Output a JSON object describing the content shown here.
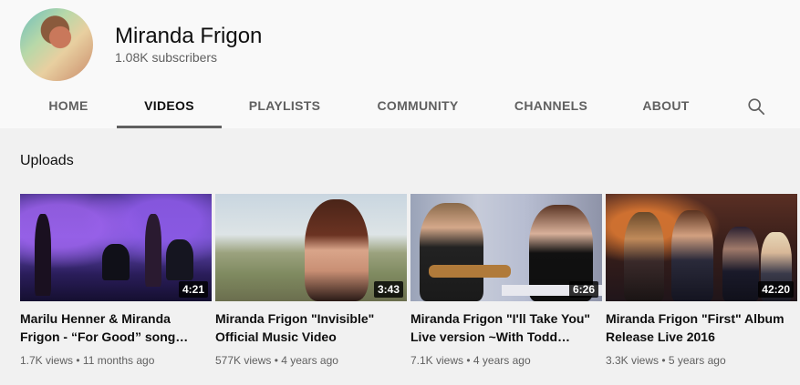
{
  "channel": {
    "name": "Miranda Frigon",
    "subscribers": "1.08K subscribers"
  },
  "tabs": [
    {
      "label": "HOME",
      "active": false
    },
    {
      "label": "VIDEOS",
      "active": true
    },
    {
      "label": "PLAYLISTS",
      "active": false
    },
    {
      "label": "COMMUNITY",
      "active": false
    },
    {
      "label": "CHANNELS",
      "active": false
    },
    {
      "label": "ABOUT",
      "active": false
    }
  ],
  "search_icon": "search-icon",
  "section_title": "Uploads",
  "videos": [
    {
      "title": "Marilu Henner & Miranda Frigon - “For Good” song…",
      "duration": "4:21",
      "views": "1.7K views",
      "age": "11 months ago"
    },
    {
      "title": "Miranda Frigon \"Invisible\" Official Music Video",
      "duration": "3:43",
      "views": "577K views",
      "age": "4 years ago"
    },
    {
      "title": "Miranda Frigon \"I'll Take You\" Live version ~With Todd…",
      "duration": "6:26",
      "views": "7.1K views",
      "age": "4 years ago"
    },
    {
      "title": "Miranda Frigon \"First\" Album Release Live 2016",
      "duration": "42:20",
      "views": "3.3K views",
      "age": "5 years ago"
    }
  ],
  "meta_separator": " • ",
  "colors": {
    "header_bg": "#f9f9f9",
    "page_bg": "#f1f1f1",
    "text_primary": "#0f0f0f",
    "text_secondary": "#606060"
  }
}
